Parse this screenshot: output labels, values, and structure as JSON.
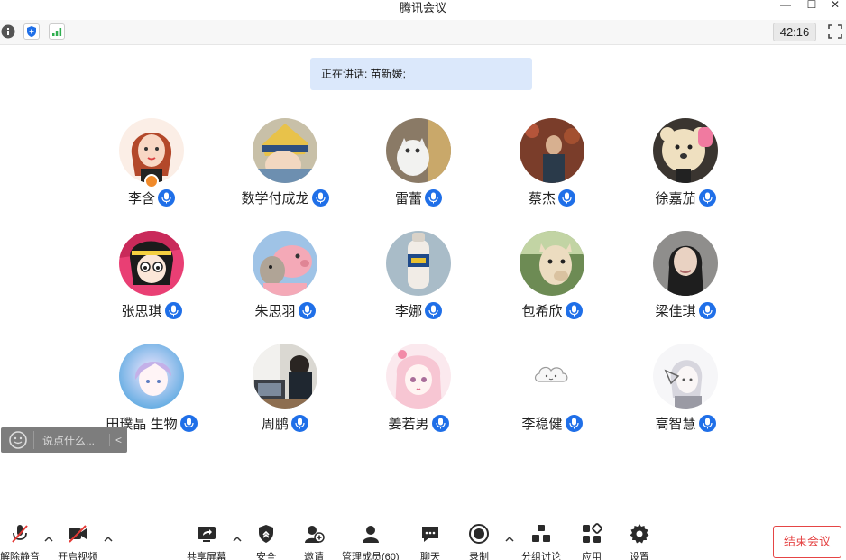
{
  "window": {
    "title": "腾讯会议",
    "controls": [
      "minimize-icon",
      "maximize-icon",
      "close-icon"
    ]
  },
  "topbar": {
    "icons": [
      "info-icon",
      "shield-icon",
      "signal-icon"
    ],
    "timer": "42:16",
    "fullscreen_icon": "fullscreen-icon"
  },
  "speaking": {
    "text": "正在讲话: 苗新媛;"
  },
  "members": [
    {
      "name": "李含",
      "host": true
    },
    {
      "name": "数学付成龙",
      "host": false
    },
    {
      "name": "雷蕾",
      "host": false
    },
    {
      "name": "蔡杰",
      "host": false
    },
    {
      "name": "徐嘉茄",
      "host": false
    },
    {
      "name": "张思琪",
      "host": false
    },
    {
      "name": "朱思羽",
      "host": false
    },
    {
      "name": "李娜",
      "host": false
    },
    {
      "name": "包希欣",
      "host": false
    },
    {
      "name": "梁佳琪",
      "host": false
    },
    {
      "name": "田璞晶 生物",
      "host": false
    },
    {
      "name": "周鹏",
      "host": false
    },
    {
      "name": "姜若男",
      "host": false
    },
    {
      "name": "李稳健",
      "host": false
    },
    {
      "name": "高智慧",
      "host": false
    }
  ],
  "chat": {
    "placeholder": "说点什么..."
  },
  "bottombar": {
    "unmute": "解除静音",
    "video": "开启视频",
    "share": "共享屏幕",
    "security": "安全",
    "invite": "邀请",
    "manage": "管理成员(60)",
    "chat": "聊天",
    "record": "录制",
    "breakout": "分组讨论",
    "apps": "应用",
    "settings": "设置",
    "end": "结束会议"
  },
  "colors": {
    "accent": "#1f6fe8",
    "speaking_bg": "#dbe8fb",
    "end_red": "#e54545"
  }
}
